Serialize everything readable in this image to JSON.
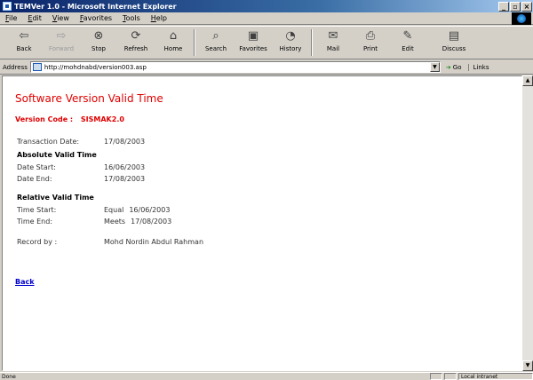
{
  "window": {
    "title": "TEMVer 1.0 - Microsoft Internet Explorer",
    "minimize": "_",
    "maximize": "▫",
    "close": "×"
  },
  "menu": [
    "File",
    "Edit",
    "View",
    "Favorites",
    "Tools",
    "Help"
  ],
  "toolbar": {
    "back": "Back",
    "forward": "Forward",
    "stop": "Stop",
    "refresh": "Refresh",
    "home": "Home",
    "search": "Search",
    "favorites": "Favorites",
    "history": "History",
    "mail": "Mail",
    "print": "Print",
    "edit": "Edit",
    "discuss": "Discuss"
  },
  "address": {
    "label": "Address",
    "url": "http://mohdnabd/version003.asp",
    "go": "Go",
    "links": "Links"
  },
  "page": {
    "title": "Software Version Valid Time",
    "version_label": "Version Code :",
    "version_code": "SISMAK2.0",
    "transaction_label": "Transaction Date:",
    "transaction_value": "17/08/2003",
    "absolute_heading": "Absolute Valid Time",
    "date_start_label": "Date Start:",
    "date_start_value": "16/06/2003",
    "date_end_label": "Date End:",
    "date_end_value": "17/08/2003",
    "relative_heading": "Relative Valid Time",
    "time_start_label": "Time Start:",
    "time_start_op": "Equal",
    "time_start_value": "16/06/2003",
    "time_end_label": "Time End:",
    "time_end_op": "Meets",
    "time_end_value": "17/08/2003",
    "record_label": "Record by :",
    "record_value": "Mohd Nordin Abdul Rahman",
    "back_link": "Back"
  },
  "status": {
    "text": "Done",
    "zone": "Local intranet"
  }
}
